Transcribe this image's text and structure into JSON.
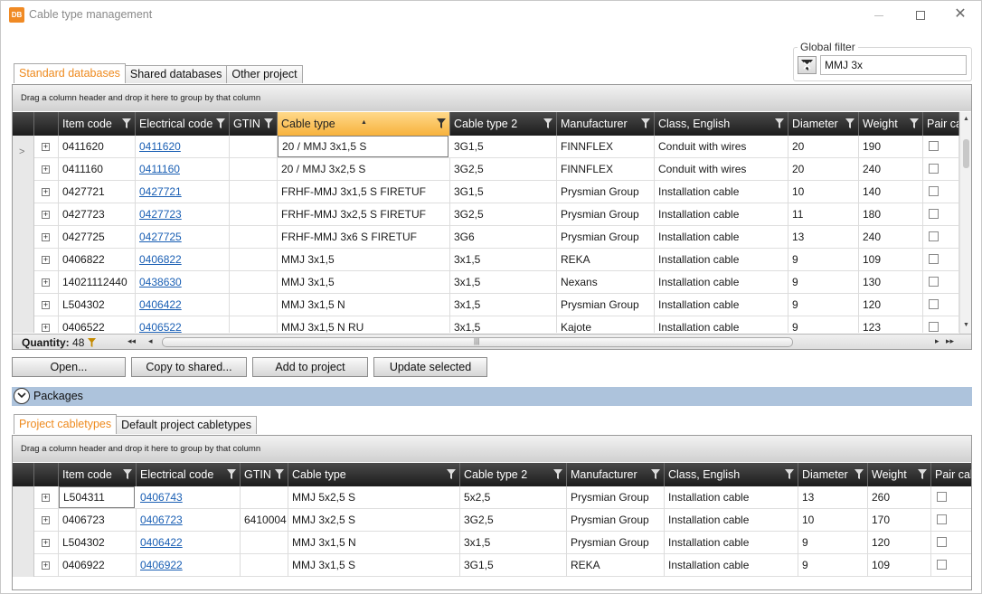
{
  "window": {
    "title": "Cable type management",
    "app_badge": "DB"
  },
  "global_filter": {
    "label": "Global filter",
    "value": "MMJ 3x"
  },
  "top_tabs": [
    {
      "label": "Standard databases",
      "active": true
    },
    {
      "label": "Shared databases",
      "active": false
    },
    {
      "label": "Other project",
      "active": false
    }
  ],
  "top_grid": {
    "group_hint": "Drag a column header and drop it here to group by that column",
    "columns": [
      "Item code",
      "Electrical code",
      "GTIN",
      "Cable type",
      "Cable type 2",
      "Manufacturer",
      "Class, English",
      "Diameter",
      "Weight",
      "Pair cable"
    ],
    "sorted_column": "Cable type",
    "rows": [
      {
        "item_code": "0411620",
        "electrical_code": "0411620",
        "gtin": "",
        "cable_type": "20 / MMJ 3x1,5 S",
        "cable_type_2": "3G1,5",
        "manufacturer": "FINNFLEX",
        "class_english": "Conduit with wires",
        "diameter": "20",
        "weight": "190"
      },
      {
        "item_code": "0411160",
        "electrical_code": "0411160",
        "gtin": "",
        "cable_type": "20 / MMJ 3x2,5 S",
        "cable_type_2": "3G2,5",
        "manufacturer": "FINNFLEX",
        "class_english": "Conduit with wires",
        "diameter": "20",
        "weight": "240"
      },
      {
        "item_code": "0427721",
        "electrical_code": "0427721",
        "gtin": "",
        "cable_type": "FRHF-MMJ 3x1,5 S FIRETUF",
        "cable_type_2": "3G1,5",
        "manufacturer": "Prysmian Group",
        "class_english": "Installation cable",
        "diameter": "10",
        "weight": "140"
      },
      {
        "item_code": "0427723",
        "electrical_code": "0427723",
        "gtin": "",
        "cable_type": "FRHF-MMJ 3x2,5 S FIRETUF",
        "cable_type_2": "3G2,5",
        "manufacturer": "Prysmian Group",
        "class_english": "Installation cable",
        "diameter": "11",
        "weight": "180"
      },
      {
        "item_code": "0427725",
        "electrical_code": "0427725",
        "gtin": "",
        "cable_type": "FRHF-MMJ 3x6 S FIRETUF",
        "cable_type_2": "3G6",
        "manufacturer": "Prysmian Group",
        "class_english": "Installation cable",
        "diameter": "13",
        "weight": "240"
      },
      {
        "item_code": "0406822",
        "electrical_code": "0406822",
        "gtin": "",
        "cable_type": "MMJ 3x1,5",
        "cable_type_2": "3x1,5",
        "manufacturer": "REKA",
        "class_english": "Installation cable",
        "diameter": "9",
        "weight": "109"
      },
      {
        "item_code": "14021112440",
        "electrical_code": "0438630",
        "gtin": "",
        "cable_type": "MMJ 3x1,5",
        "cable_type_2": "3x1,5",
        "manufacturer": "Nexans",
        "class_english": "Installation cable",
        "diameter": "9",
        "weight": "130"
      },
      {
        "item_code": "L504302",
        "electrical_code": "0406422",
        "gtin": "",
        "cable_type": "MMJ 3x1,5 N",
        "cable_type_2": "3x1,5",
        "manufacturer": "Prysmian Group",
        "class_english": "Installation cable",
        "diameter": "9",
        "weight": "120"
      },
      {
        "item_code": "0406522",
        "electrical_code": "0406522",
        "gtin": "",
        "cable_type": "MMJ 3x1,5 N RU",
        "cable_type_2": "3x1,5",
        "manufacturer": "Kajote",
        "class_english": "Installation cable",
        "diameter": "9",
        "weight": "123"
      }
    ],
    "quantity_label": "Quantity:",
    "quantity_value": "48"
  },
  "actions": {
    "open": "Open...",
    "copy_to_shared": "Copy to shared...",
    "add_to_project": "Add to project",
    "update_selected": "Update selected"
  },
  "packages": {
    "label": "Packages"
  },
  "bottom_tabs": [
    {
      "label": "Project cabletypes",
      "active": true
    },
    {
      "label": "Default project cabletypes",
      "active": false
    }
  ],
  "bottom_grid": {
    "group_hint": "Drag a column header and drop it here to group by that column",
    "columns": [
      "Item code",
      "Electrical code",
      "GTIN",
      "Cable type",
      "Cable type 2",
      "Manufacturer",
      "Class, English",
      "Diameter",
      "Weight",
      "Pair cable"
    ],
    "rows": [
      {
        "item_code": "L504311",
        "electrical_code": "0406743",
        "gtin": "",
        "cable_type": "MMJ 5x2,5 S",
        "cable_type_2": "5x2,5",
        "manufacturer": "Prysmian Group",
        "class_english": "Installation cable",
        "diameter": "13",
        "weight": "260"
      },
      {
        "item_code": "0406723",
        "electrical_code": "0406723",
        "gtin": "6410004",
        "cable_type": "MMJ 3x2,5 S",
        "cable_type_2": "3G2,5",
        "manufacturer": "Prysmian Group",
        "class_english": "Installation cable",
        "diameter": "10",
        "weight": "170"
      },
      {
        "item_code": "L504302",
        "electrical_code": "0406422",
        "gtin": "",
        "cable_type": "MMJ 3x1,5 N",
        "cable_type_2": "3x1,5",
        "manufacturer": "Prysmian Group",
        "class_english": "Installation cable",
        "diameter": "9",
        "weight": "120"
      },
      {
        "item_code": "0406922",
        "electrical_code": "0406922",
        "gtin": "",
        "cable_type": "MMJ 3x1,5 S",
        "cable_type_2": "3G1,5",
        "manufacturer": "REKA",
        "class_english": "Installation cable",
        "diameter": "9",
        "weight": "109"
      }
    ]
  }
}
